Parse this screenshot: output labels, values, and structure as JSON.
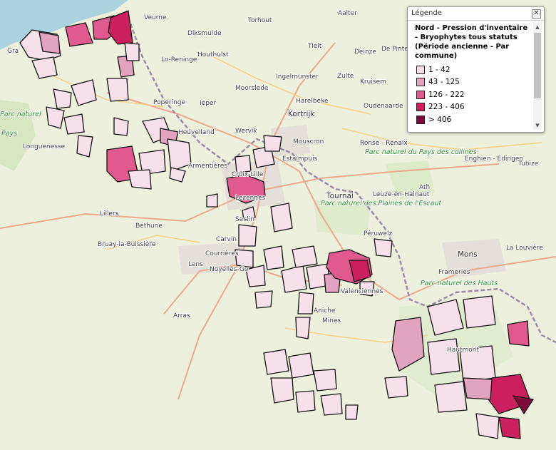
{
  "legend": {
    "header": "Légende",
    "close_symbol": "✕",
    "title_lines": [
      "Nord - Pression d'inventaire",
      "- Bryophytes tous statuts",
      "(Période ancienne - Par",
      "commune)"
    ],
    "classes": [
      {
        "label": "1 - 42",
        "color": "#f6e0ea"
      },
      {
        "label": "43 - 125",
        "color": "#e2a3bf"
      },
      {
        "label": "126 - 222",
        "color": "#e05a8e"
      },
      {
        "label": "223 - 406",
        "color": "#cc1f5d"
      },
      {
        "label": "> 406",
        "color": "#7e0a3a"
      }
    ]
  },
  "places": [
    "Veurne",
    "Torhout",
    "Aalter",
    "Diksmuide",
    "Tielt",
    "Deinze",
    "De Pinte",
    "Houthulst",
    "Lo-Reninge",
    "Ingelmunster",
    "Zulte",
    "Kruisem",
    "Moorslede",
    "Harelbeke",
    "Poperinge",
    "Ieper",
    "Oudenaarde",
    "Kortrijk",
    "Heuvelland",
    "Wervik",
    "Mouscron",
    "Ronse - Renaix",
    "Estaimpuis",
    "Longuenesse",
    "Armentières",
    "Enghien - Edingen",
    "Tubize",
    "Tournai",
    "Leuze-en-Hainaut",
    "Ath",
    "Lillers",
    "Béthune",
    "Seclin",
    "Carvin",
    "Bruay-la-Buissière",
    "Courrières",
    "Péruwelz",
    "Lens",
    "Noyelles-Go",
    "Mons",
    "La Louvière",
    "Frameries",
    "Valenciennes",
    "Arras",
    "Aniche",
    "Mines",
    "Hautmont",
    "Croix-Lille",
    "Lezennes",
    "Gra",
    "Pays",
    "Parc naturel",
    "Parc naturel du Pays des collines",
    "Parc naturel des Plaines de l'Escaut",
    "Parc naturel des Hauts"
  ]
}
